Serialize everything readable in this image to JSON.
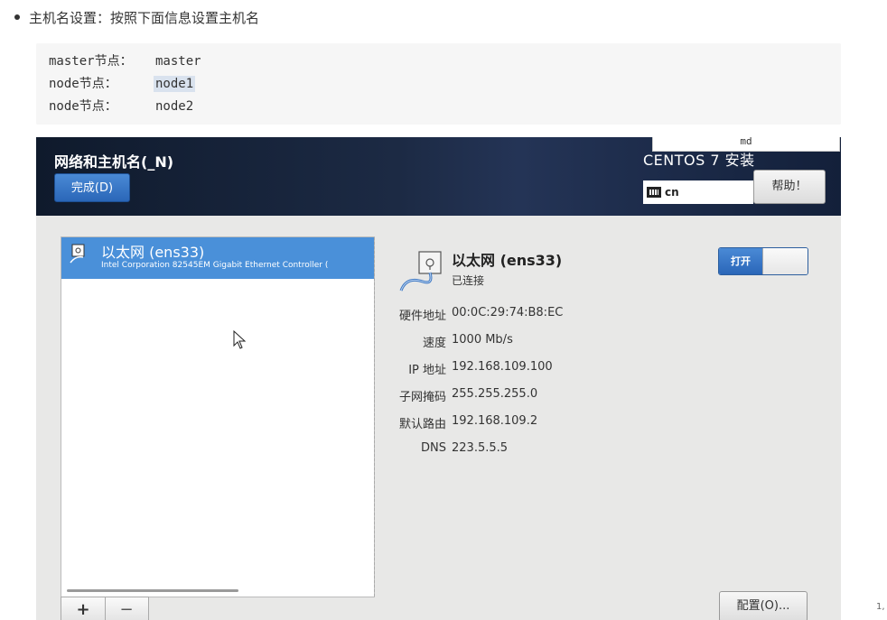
{
  "doc": {
    "bullet": "主机名设置：按照下面信息设置主机名",
    "code_rows": [
      {
        "key": "master节点：",
        "value": "master"
      },
      {
        "key": "node节点：",
        "value": "node1"
      },
      {
        "key": "node节点：",
        "value": "node2"
      }
    ],
    "page_number": "1,"
  },
  "installer": {
    "title": "网络和主机名(_N)",
    "done_label": "完成(D)",
    "product": "CENTOS 7 安装",
    "md_label": "md",
    "keyboard_layout": "cn",
    "help_label": "帮助！",
    "list": {
      "items": [
        {
          "name": "以太网 (ens33)",
          "desc": "Intel Corporation 82545EM Gigabit Ethernet Controller (",
          "selected": true
        }
      ],
      "add_label": "+",
      "remove_label": "−"
    },
    "detail": {
      "name": "以太网 (ens33)",
      "status": "已连接",
      "toggle_label": "打开",
      "rows": [
        {
          "label": "硬件地址",
          "value": "00:0C:29:74:B8:EC"
        },
        {
          "label": "速度",
          "value": "1000 Mb/s"
        },
        {
          "label": "IP 地址",
          "value": "192.168.109.100"
        },
        {
          "label": "子网掩码",
          "value": "255.255.255.0"
        },
        {
          "label": "默认路由",
          "value": "192.168.109.2"
        },
        {
          "label": "DNS",
          "value": "223.5.5.5"
        }
      ],
      "config_label": "配置(O)..."
    }
  },
  "colors": {
    "header_bg": "#1c2a44",
    "accent_blue": "#2a66b8",
    "selection_blue": "#4a90d9",
    "code_bg": "#f6f6f6"
  }
}
